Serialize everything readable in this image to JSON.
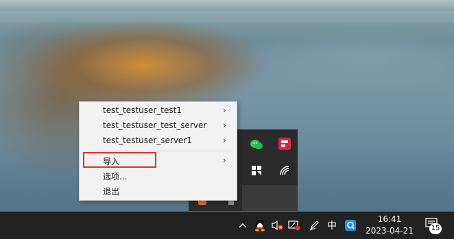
{
  "menu": {
    "items": [
      {
        "label": "test_testuser_test1",
        "submenu": true
      },
      {
        "label": "test_testuser_test_server",
        "submenu": true
      },
      {
        "label": "test_testuser_server1",
        "submenu": true
      },
      {
        "label": "导入",
        "submenu": true,
        "highlighted": true
      },
      {
        "label": "选项...",
        "submenu": false
      },
      {
        "label": "退出",
        "submenu": false
      }
    ],
    "submenu_arrow": "›"
  },
  "flyout": {
    "icons": [
      "wechat-icon",
      "red-app-icon",
      "app-grid-icon",
      "wireless-icon",
      "orange-app-icon",
      "usb-icon"
    ]
  },
  "taskbar": {
    "ime_label": "中",
    "clock_time": "16:41",
    "clock_date": "2023-04-21",
    "notification_count": "15",
    "up_arrow": "^"
  },
  "colors": {
    "taskbar": "#222223",
    "menu_bg": "#f2f2f2",
    "highlight_border": "#e03030",
    "wechat_green": "#2ec45a",
    "qq_blue": "#1f8fe8"
  }
}
